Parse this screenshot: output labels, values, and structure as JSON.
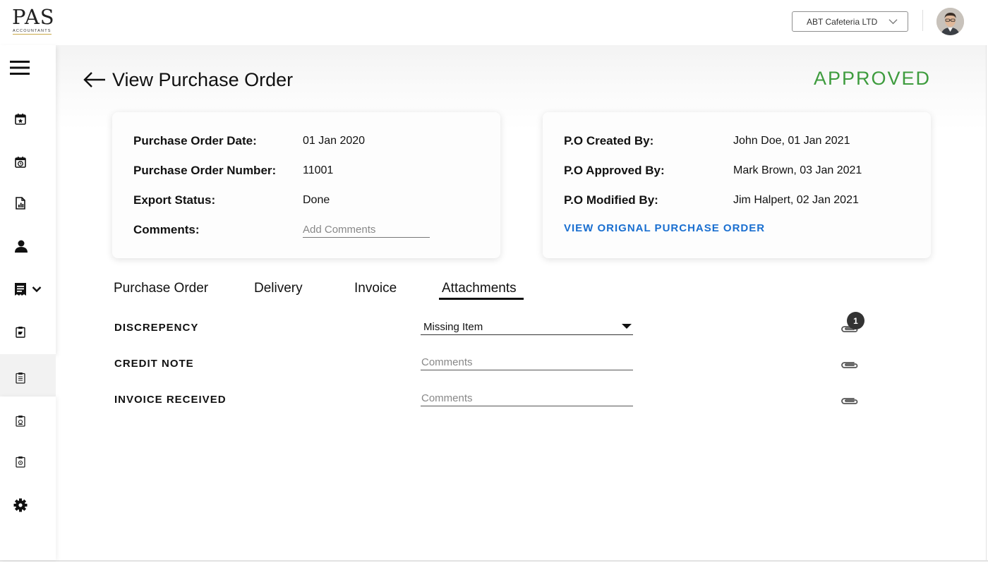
{
  "brand": {
    "name": "PAS",
    "subtitle": "ACCOUNTANTS"
  },
  "header": {
    "company_selected": "ABT Cafeteria LTD"
  },
  "page": {
    "title": "View Purchase Order",
    "status": "APPROVED",
    "status_color": "#3e9c3e"
  },
  "order_card": {
    "rows": [
      {
        "label": "Purchase Order Date:",
        "value": "01 Jan 2020"
      },
      {
        "label": "Purchase Order Number:",
        "value": "11001"
      },
      {
        "label": "Export Status:",
        "value": "Done"
      }
    ],
    "comments_label": "Comments:",
    "comments_placeholder": "Add Comments"
  },
  "audit_card": {
    "rows": [
      {
        "label": "P.O Created By:",
        "value": "John Doe, 01 Jan 2021"
      },
      {
        "label": "P.O Approved By:",
        "value": "Mark Brown, 03 Jan 2021"
      },
      {
        "label": "P.O Modified By:",
        "value": "Jim Halpert, 02 Jan 2021"
      }
    ],
    "link_label": "VIEW ORIGNAL PURCHASE ORDER",
    "link_color": "#1a6fd0"
  },
  "tabs": [
    {
      "label": "Purchase Order",
      "active": false
    },
    {
      "label": "Delivery",
      "active": false
    },
    {
      "label": "Invoice",
      "active": false
    },
    {
      "label": "Attachments",
      "active": true
    }
  ],
  "attachments": [
    {
      "label": "DISCREPENCY",
      "field_value": "Missing Item",
      "count": "1"
    },
    {
      "label": "CREDIT NOTE",
      "placeholder": "Comments"
    },
    {
      "label": "INVOICE RECEIVED",
      "placeholder": "Comments"
    }
  ],
  "sidebar_icons": [
    "menu-icon",
    "calendar-star-icon",
    "calendar-clock-icon",
    "document-chart-icon",
    "user-icon",
    "receipt-icon",
    "chevron-down-icon",
    "clipboard-icon",
    "clipboard-list-icon",
    "clipboard-check-icon",
    "clipboard-alt-icon",
    "gear-icon"
  ]
}
